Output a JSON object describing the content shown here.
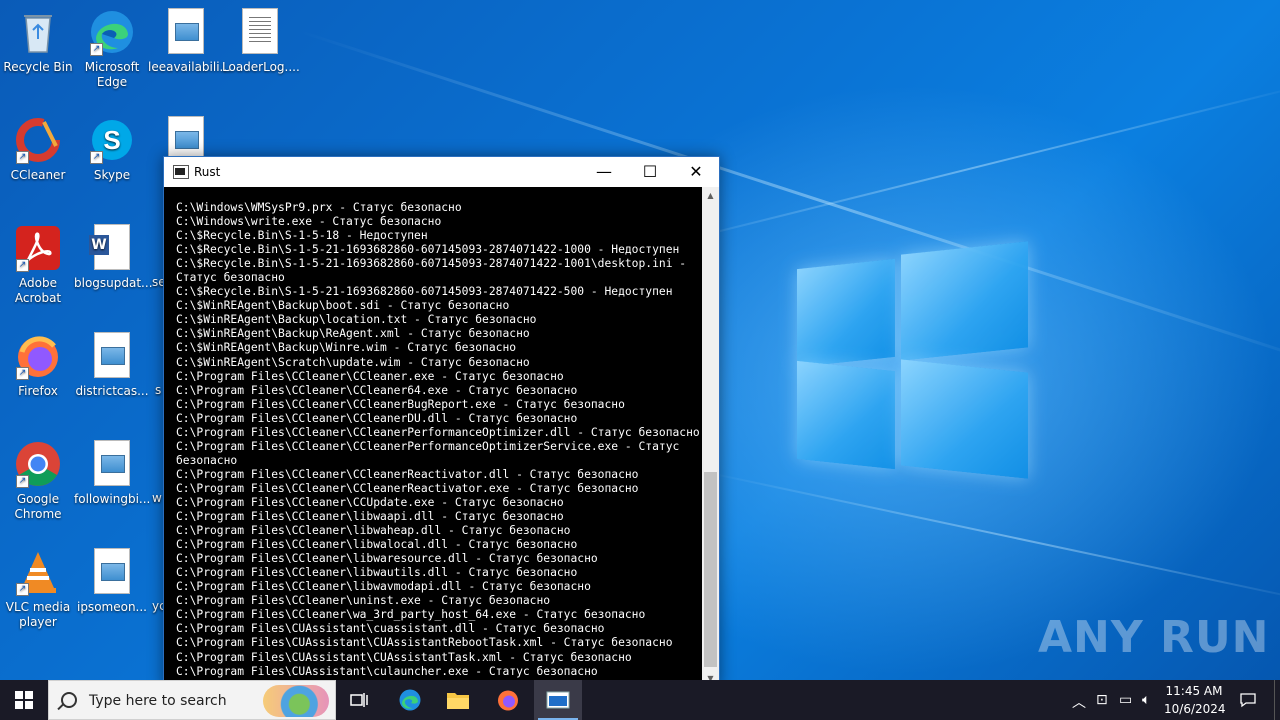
{
  "desktop": {
    "icons": [
      {
        "label": "Recycle Bin"
      },
      {
        "label": "Microsoft\nEdge"
      },
      {
        "label": "leeavailabili..."
      },
      {
        "label": "LoaderLog...."
      },
      {
        "label": "CCleaner"
      },
      {
        "label": "Skype"
      },
      {
        "label": "Adobe\nAcrobat"
      },
      {
        "label": "blogsupdat..."
      },
      {
        "label": "Firefox"
      },
      {
        "label": "districtcas..."
      },
      {
        "label": "Google\nChrome"
      },
      {
        "label": "followingbi..."
      },
      {
        "label": "VLC media\nplayer"
      },
      {
        "label": "ipsomeon..."
      }
    ],
    "partial_labels": [
      "se",
      "s",
      "w",
      "yc"
    ]
  },
  "console_window": {
    "title": "Rust",
    "minimize_glyph": "—",
    "maximize_glyph": "☐",
    "close_glyph": "✕",
    "lines": [
      "C:\\Windows\\WMSysPr9.prx - Статус безопасно",
      "C:\\Windows\\write.exe - Статус безопасно",
      "C:\\$Recycle.Bin\\S-1-5-18 - Недоступен",
      "C:\\$Recycle.Bin\\S-1-5-21-1693682860-607145093-2874071422-1000 - Недоступен",
      "C:\\$Recycle.Bin\\S-1-5-21-1693682860-607145093-2874071422-1001\\desktop.ini -",
      "Статус безопасно",
      "C:\\$Recycle.Bin\\S-1-5-21-1693682860-607145093-2874071422-500 - Недоступен",
      "C:\\$WinREAgent\\Backup\\boot.sdi - Статус безопасно",
      "C:\\$WinREAgent\\Backup\\location.txt - Статус безопасно",
      "C:\\$WinREAgent\\Backup\\ReAgent.xml - Статус безопасно",
      "C:\\$WinREAgent\\Backup\\Winre.wim - Статус безопасно",
      "C:\\$WinREAgent\\Scratch\\update.wim - Статус безопасно",
      "C:\\Program Files\\CCleaner\\CCleaner.exe - Статус безопасно",
      "C:\\Program Files\\CCleaner\\CCleaner64.exe - Статус безопасно",
      "C:\\Program Files\\CCleaner\\CCleanerBugReport.exe - Статус безопасно",
      "C:\\Program Files\\CCleaner\\CCleanerDU.dll - Статус безопасно",
      "C:\\Program Files\\CCleaner\\CCleanerPerformanceOptimizer.dll - Статус безопасно",
      "C:\\Program Files\\CCleaner\\CCleanerPerformanceOptimizerService.exe - Статус",
      "безопасно",
      "C:\\Program Files\\CCleaner\\CCleanerReactivator.dll - Статус безопасно",
      "C:\\Program Files\\CCleaner\\CCleanerReactivator.exe - Статус безопасно",
      "C:\\Program Files\\CCleaner\\CCUpdate.exe - Статус безопасно",
      "C:\\Program Files\\CCleaner\\libwaapi.dll - Статус безопасно",
      "C:\\Program Files\\CCleaner\\libwaheap.dll - Статус безопасно",
      "C:\\Program Files\\CCleaner\\libwalocal.dll - Статус безопасно",
      "C:\\Program Files\\CCleaner\\libwaresource.dll - Статус безопасно",
      "C:\\Program Files\\CCleaner\\libwautils.dll - Статус безопасно",
      "C:\\Program Files\\CCleaner\\libwavmodapi.dll - Статус безопасно",
      "C:\\Program Files\\CCleaner\\uninst.exe - Статус безопасно",
      "C:\\Program Files\\CCleaner\\wa_3rd_party_host_64.exe - Статус безопасно",
      "C:\\Program Files\\CUAssistant\\cuassistant.dll - Статус безопасно",
      "C:\\Program Files\\CUAssistant\\CUAssistantRebootTask.xml - Статус безопасно",
      "C:\\Program Files\\CUAssistant\\CUAssistantTask.xml - Статус безопасно",
      "C:\\Program Files\\CUAssistant\\culauncher.exe - Статус безопасно"
    ]
  },
  "watermark": "ANY  RUN",
  "taskbar": {
    "search_placeholder": "Type here to search",
    "time": "11:45 AM",
    "date": "10/6/2024",
    "accent_color": "#7ab4ee"
  }
}
